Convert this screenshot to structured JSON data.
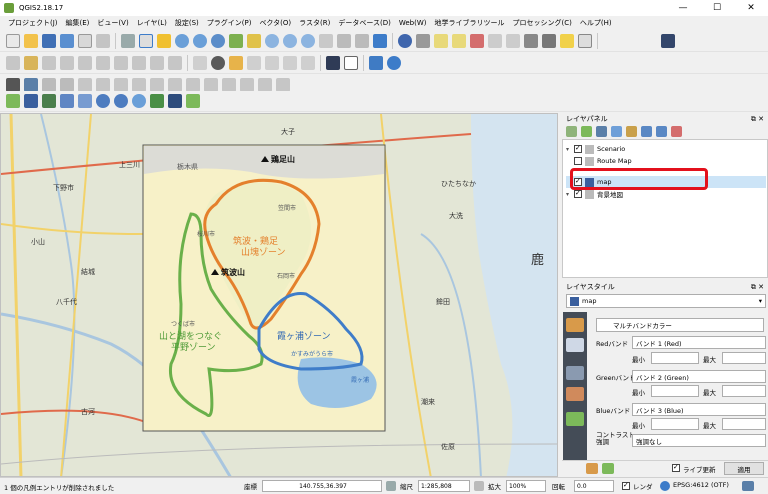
{
  "window": {
    "title": "QGIS2.18.17",
    "controls": [
      "—",
      "☐",
      "✕"
    ]
  },
  "menu": [
    "プロジェクト(J)",
    "編集(E)",
    "ビュー(V)",
    "レイヤ(L)",
    "設定(S)",
    "プラグイン(P)",
    "ベクタ(O)",
    "ラスタ(R)",
    "データベース(D)",
    "Web(W)",
    "地学ライブラリツール",
    "プロセッシング(C)",
    "ヘルプ(H)"
  ],
  "map": {
    "overlay_labels": {
      "tochigi": "栃木県",
      "mount_ashio": "鶏足山",
      "mount_tsukuba": "筑波山",
      "zone_orange": "筑波・鶏足\n山塊ゾーン",
      "zone_green": "山と湖をつなぐ\n平野ゾーン",
      "zone_blue": "霞ヶ浦ゾーン",
      "city_kasumigaura": "かすみがうら市",
      "city_tsukuba": "つくば市",
      "city_sakuragawa": "桜川市",
      "city_kasama": "笠間市",
      "city_ishioka": "石岡市",
      "lake_label": "霞ヶ浦",
      "sea_label": "鹿"
    },
    "basemap_labels": [
      "上三川",
      "下野市",
      "結城",
      "小山",
      "八千代",
      "古河",
      "大子",
      "ひたちなか",
      "大洗",
      "鉾田",
      "潮来",
      "佐原"
    ]
  },
  "layer_panel": {
    "title": "レイヤパネル",
    "layers": [
      {
        "name": "Scenario",
        "checked": true,
        "expanded": true
      },
      {
        "name": "Route Map",
        "checked": false,
        "expanded": false
      },
      {
        "name": "map",
        "checked": true,
        "expanded": false
      },
      {
        "name": "背景地図",
        "checked": true,
        "expanded": true
      }
    ]
  },
  "style_panel": {
    "title": "レイヤスタイル",
    "layer": "map",
    "renderer": "マルチバンドカラー",
    "red_label": "Redバンド",
    "red_band": "バンド 1 (Red)",
    "green_label": "Greenバンド",
    "green_band": "バンド 2 (Green)",
    "blue_label": "Blueバンド",
    "blue_band": "バンド 3 (Blue)",
    "min_label": "最小",
    "max_label": "最大",
    "contrast_label": "コントラスト\n強調",
    "contrast_value": "強調なし",
    "live_update": "ライブ更新",
    "apply": "適用"
  },
  "statusbar": {
    "message": "1 個の凡例エントリが削除されました",
    "coord_label": "座標",
    "coord_value": "140.755,36.397",
    "scale_label": "縮尺",
    "scale_value": "1:285,808",
    "magnifier_label": "拡大",
    "magnifier_value": "100%",
    "rotation_label": "回転",
    "rotation_value": "0.0",
    "render_label": "レンダ",
    "crs": "EPSG:4612 (OTF)"
  }
}
